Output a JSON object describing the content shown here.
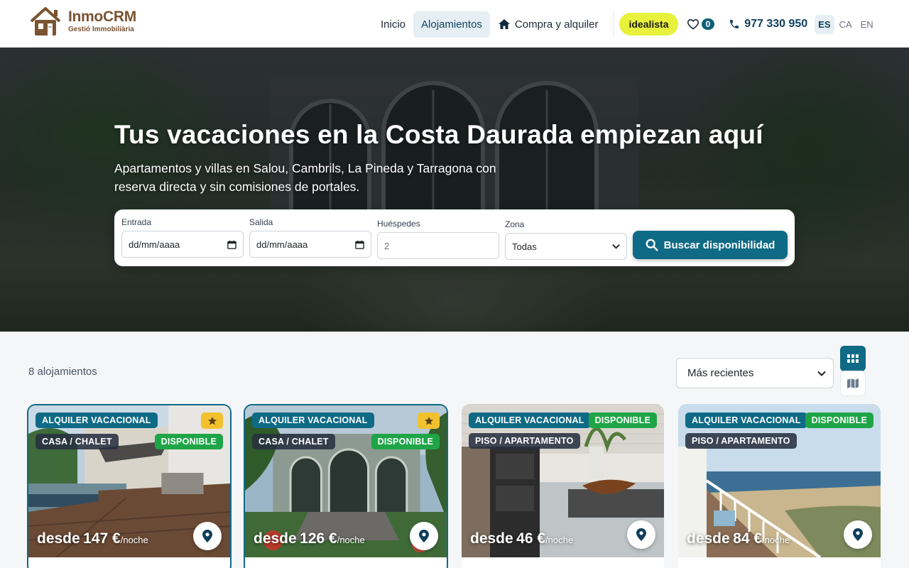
{
  "brand": {
    "name": "InmoCRM",
    "tagline": "Gestió Immobiliària",
    "color": "#7a5331"
  },
  "nav": {
    "items": [
      {
        "label": "Inicio",
        "active": false
      },
      {
        "label": "Alojamientos",
        "active": true
      },
      {
        "label": "Compra y alquiler",
        "active": false,
        "icon": "home-icon"
      }
    ],
    "idealista": "idealista",
    "favorites_count": "0",
    "phone": "977 330 950",
    "languages": [
      {
        "code": "ES",
        "active": true
      },
      {
        "code": "CA",
        "active": false
      },
      {
        "code": "EN",
        "active": false
      }
    ]
  },
  "hero": {
    "title": "Tus vacaciones en la Costa Daurada empiezan aquí",
    "subtitle": "Apartamentos y villas en Salou, Cambrils, La Pineda y Tarragona con reserva directa y sin comisiones de portales."
  },
  "search": {
    "checkin_label": "Entrada",
    "checkin_value": "dd/mm/aaaa",
    "checkout_label": "Salida",
    "checkout_value": "dd/mm/aaaa",
    "guests_label": "Huéspedes",
    "guests_placeholder": "2",
    "zone_label": "Zona",
    "zone_value": "Todas",
    "button_label": "Buscar disponibilidad"
  },
  "listing": {
    "count_label": "8 alojamientos",
    "sort_value": "Más recientes"
  },
  "cards": [
    {
      "type": "ALQUILER VACACIONAL",
      "category": "CASA / CHALET",
      "status": "DISPONIBLE",
      "featured": true,
      "price_prefix": "desde",
      "price": "147 €",
      "unit": "/noche"
    },
    {
      "type": "ALQUILER VACACIONAL",
      "category": "CASA / CHALET",
      "status": "DISPONIBLE",
      "featured": true,
      "price_prefix": "desde",
      "price": "126 €",
      "unit": "/noche"
    },
    {
      "type": "ALQUILER VACACIONAL",
      "category": "PISO / APARTAMENTO",
      "status": "DISPONIBLE",
      "featured": false,
      "price_prefix": "desde",
      "price": "46 €",
      "unit": "/noche"
    },
    {
      "type": "ALQUILER VACACIONAL",
      "category": "PISO / APARTAMENTO",
      "status": "DISPONIBLE",
      "featured": false,
      "price_prefix": "desde",
      "price": "84 €",
      "unit": "/noche"
    }
  ],
  "colors": {
    "primary": "#0f6a85",
    "available": "#1fa547",
    "featured_star": "#f2c12e",
    "idealista": "#e8f23c"
  }
}
